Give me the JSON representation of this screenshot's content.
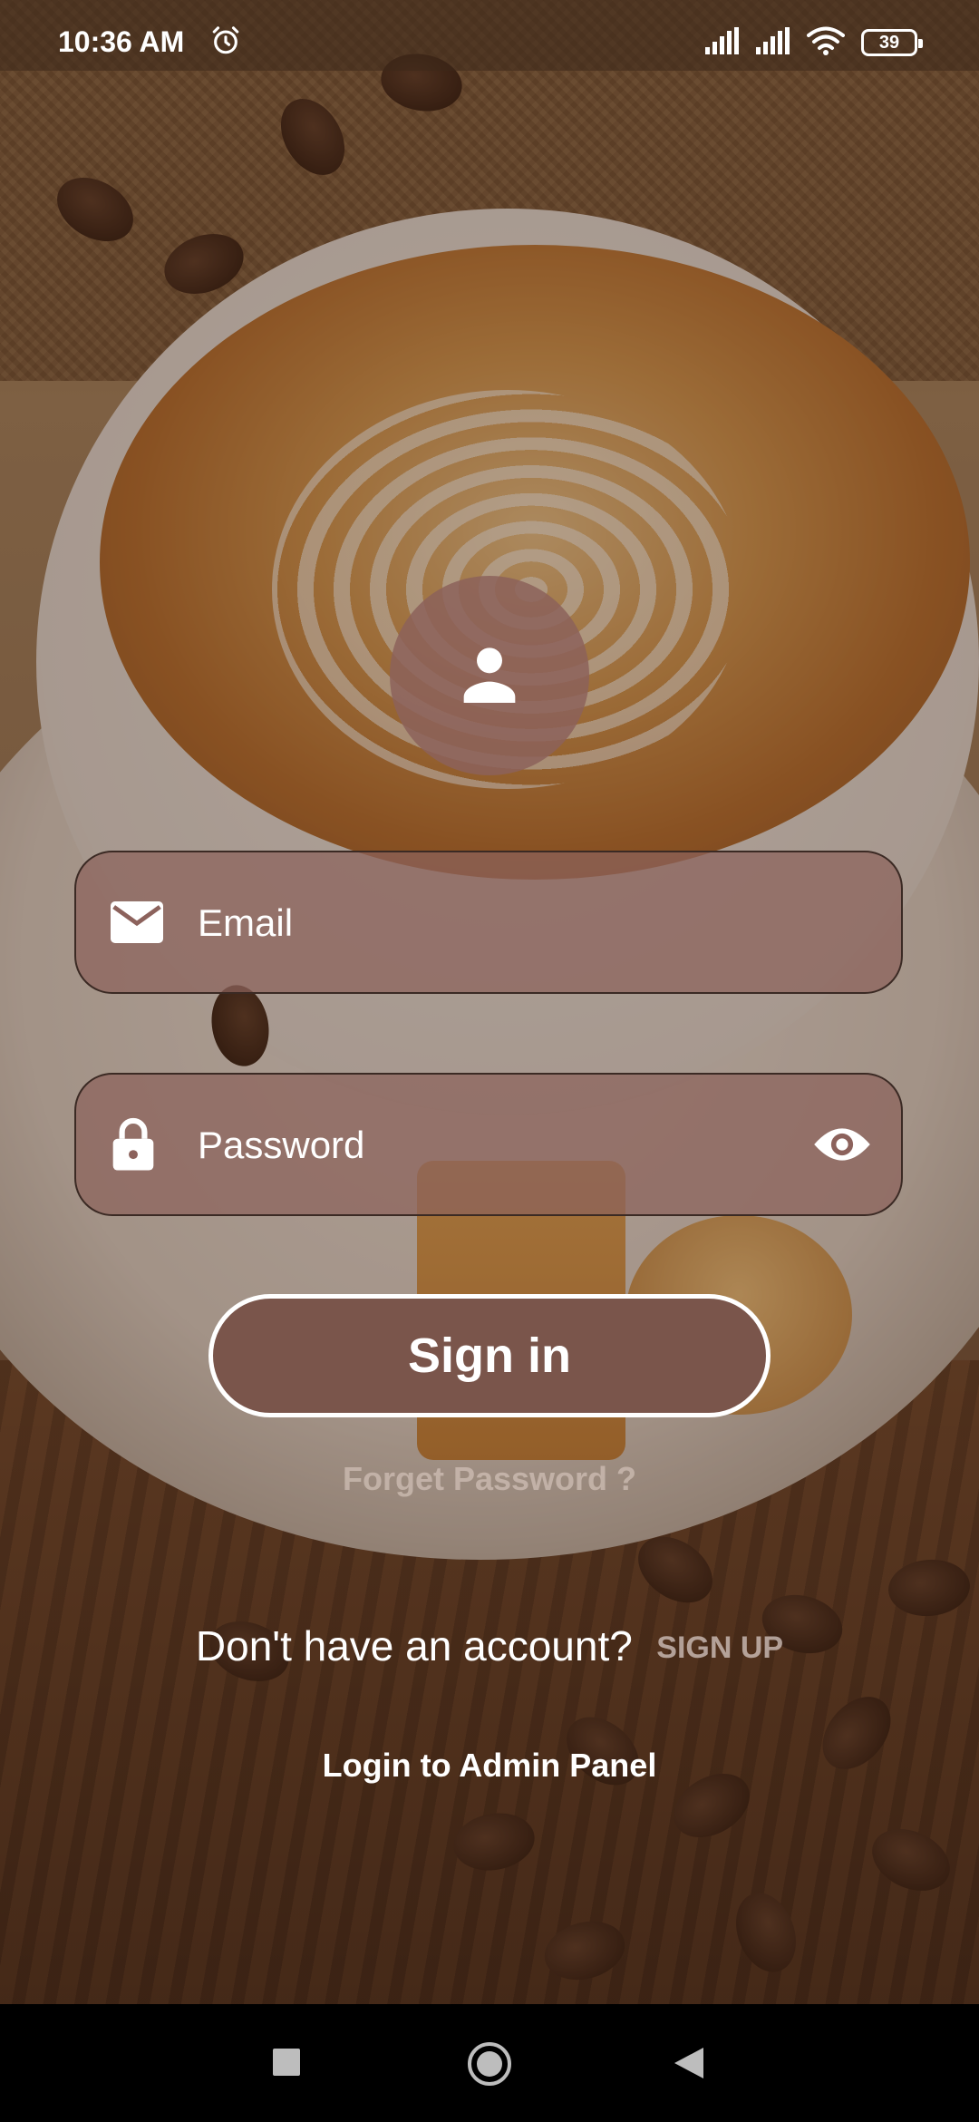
{
  "status_bar": {
    "time": "10:36 AM",
    "battery": "39",
    "icons": [
      "alarm-icon",
      "signal-icon",
      "signal-icon",
      "wifi-icon",
      "battery-icon"
    ]
  },
  "login": {
    "avatar_icon": "person-icon",
    "email": {
      "placeholder": "Email",
      "value": "",
      "icon": "mail-icon"
    },
    "password": {
      "placeholder": "Password",
      "value": "",
      "icon": "lock-icon",
      "toggle_icon": "eye-icon"
    },
    "sign_in_label": "Sign in",
    "forget_password": "Forget Password ?",
    "no_account_text": "Don't have an account?",
    "sign_up_label": "SIGN UP",
    "admin_link": "Login to Admin Panel"
  },
  "nav_bar": {
    "buttons": [
      "recents-square-icon",
      "home-circle-icon",
      "back-triangle-icon"
    ]
  },
  "colors": {
    "field_fill": "#8c625c",
    "button_fill": "#7a554b",
    "text": "#ffffff"
  }
}
